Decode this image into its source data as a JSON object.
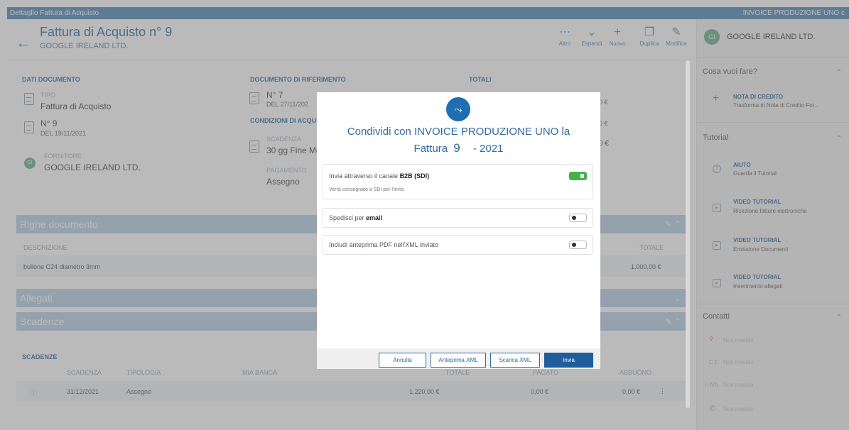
{
  "window": {
    "title": "Dettaglio Fattura di Acquisto",
    "company_right": "INVOICE PRODUZIONE UNO c"
  },
  "header": {
    "title": "Fattura di Acquisto n° 9",
    "subtitle": "GOOGLE IRELAND LTD.",
    "tools": [
      {
        "icon": "more-icon",
        "label": "Altro"
      },
      {
        "icon": "chevron-down-icon",
        "label": "Espandi"
      },
      {
        "icon": "plus-icon",
        "label": "Nuovo"
      },
      {
        "icon": "copy-icon",
        "label": "Duplica"
      },
      {
        "icon": "edit-icon",
        "label": "Modifica"
      }
    ]
  },
  "dati": {
    "title": "DATI DOCUMENTO",
    "tipo_label": "TIPO",
    "tipo_value": "Fattura di Acquisto",
    "numero_label": "N° 9",
    "numero_date": "DEL 19/11/2021",
    "fornitore_label": "FORNITORE",
    "fornitore_value": "GOOGLE IRELAND LTD.",
    "fornitore_initials": "GI"
  },
  "riferimento": {
    "title": "DOCUMENTO DI RIFERIMENTO",
    "numero": "N° 7",
    "date": "DEL 27/11/202",
    "condizioni_title": "CONDIZIONI DI ACQU",
    "scadenza_label": "SCADENZA",
    "scadenza_value": "30 gg Fine Me",
    "pagamento_label": "PAGAMENTO",
    "pagamento_value": "Assegno"
  },
  "totali": {
    "title": "TOTALI",
    "v1": "0 €",
    "v2": "0 €",
    "v3": "0 €"
  },
  "righe": {
    "title": "Righe documento",
    "col_desc": "DESCRIZIONE",
    "col_totale": "TOTALE",
    "row_desc": "bullone C24 diametro 3mm",
    "row_totale": "1.000,00 €"
  },
  "allegati": {
    "title": "Allegati"
  },
  "scadenze_band": {
    "title": "Scadenze"
  },
  "scadenze": {
    "title": "SCADENZE",
    "cols": [
      "SCADENZA",
      "TIPOLOGIA",
      "MIA BANCA",
      "TOTALE",
      "PAGATO",
      "ABBUONO"
    ],
    "row": {
      "scadenza": "31/12/2021",
      "tipologia": "Assegno",
      "totale": "1.220,00 €",
      "pagato": "0,00 €",
      "abbuono": "0,00 €"
    }
  },
  "sidebar": {
    "avatar": "GI",
    "company": "GOOGLE IRELAND LTD.",
    "cosa_title": "Cosa vuoi fare?",
    "nota_title": "NOTA DI CREDITO",
    "nota_sub": "Trasforma in Nota di Credito For...",
    "tutorial_title": "Tutorial",
    "items": [
      {
        "title": "AIUTO",
        "sub": "Guarda il Tutorial"
      },
      {
        "title": "VIDEO TUTORIAL",
        "sub": "Ricezione fatture elettroniche"
      },
      {
        "title": "VIDEO TUTORIAL",
        "sub": "Emissione Documenti"
      },
      {
        "title": "VIDEO TUTORIAL",
        "sub": "Inserimento allegati"
      }
    ],
    "contatti_title": "Contatti",
    "contacts": [
      {
        "label": "",
        "value": "Non inserito"
      },
      {
        "label": "C.F.",
        "value": "Non inserito"
      },
      {
        "label": "P.IVA",
        "value": "Non inserita"
      },
      {
        "label": "",
        "value": "Non inserito"
      }
    ]
  },
  "modal": {
    "title_line1": "Condividi con INVOICE PRODUZIONE UNO la",
    "title_doc": "Fattura",
    "title_num": "9",
    "title_year": "- 2021",
    "opt1_prefix": "Invia attraverso il canale ",
    "opt1_bold": "B2B (SDI)",
    "opt1_sub": "Verrà consegnato a SDI per l'invio",
    "opt1_on": true,
    "opt2_prefix": "Spedisci per ",
    "opt2_bold": "email",
    "opt2_on": false,
    "opt3_text": "Includi anteprima PDF nell'XML inviato",
    "opt3_on": false,
    "btn_annulla": "Annulla",
    "btn_anteprima": "Anteprima XML",
    "btn_scarica": "Scarica XML",
    "btn_invia": "Invia"
  },
  "colors": {
    "accent": "#2f6aa0",
    "band": "#b9cfe4",
    "toggle_on": "#46b14a",
    "primary": "#1f5d9c"
  }
}
